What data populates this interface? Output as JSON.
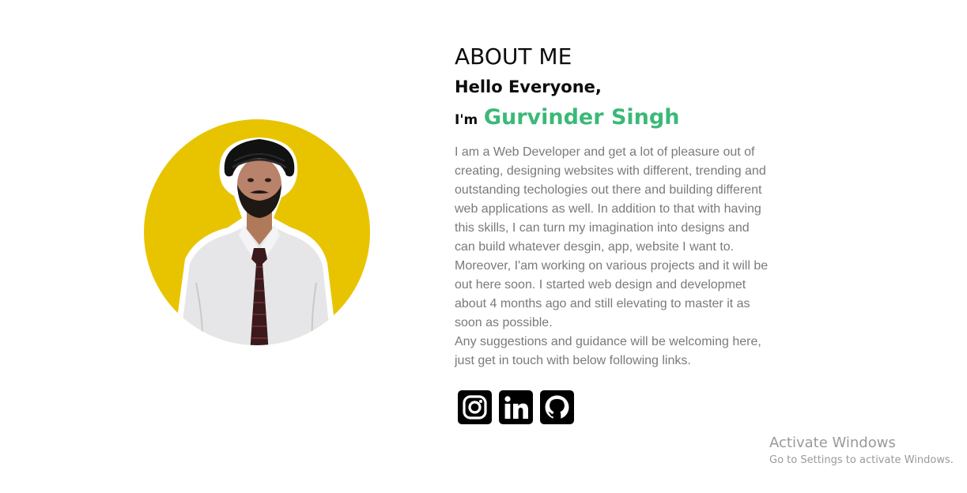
{
  "about": {
    "heading": "ABOUT ME",
    "greeting": "Hello Everyone,",
    "intro_prefix": "I'm",
    "name": "Gurvinder Singh",
    "bio_paragraph_1": "I am a Web Developer and get a lot of pleasure out of creating, designing websites with different, trending and outstanding techologies out there and building different web applications as well. In addition to that with having this skills, I can turn my imagination into designs and can build whatever desgin, app, website I want to. Moreover, I'am working on various projects and it will be out here soon. I started web design and developmet about 4 months ago and still elevating to master it as soon as possible.",
    "bio_paragraph_2": "Any suggestions and guidance will be welcoming here, just get in touch with below following links."
  },
  "socials": [
    {
      "icon": "instagram-icon"
    },
    {
      "icon": "linkedin-icon"
    },
    {
      "icon": "github-icon"
    }
  ],
  "watermark": {
    "title": "Activate Windows",
    "subtitle": "Go to Settings to activate Windows."
  },
  "colors": {
    "accent_name": "#3cb878",
    "photo_circle": "#e8c400",
    "text_dark": "#0d0d0d",
    "text_body": "#7a7a7a"
  }
}
